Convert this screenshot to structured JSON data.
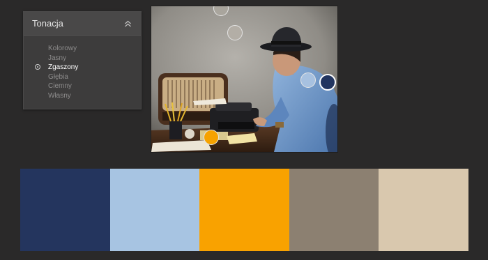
{
  "panel": {
    "title": "Tonacja",
    "collapse_icon": "chevron-double-up-icon",
    "options": [
      {
        "label": "Kolorowy",
        "selected": false
      },
      {
        "label": "Jasny",
        "selected": false
      },
      {
        "label": "Zgaszony",
        "selected": true
      },
      {
        "label": "Głębia",
        "selected": false
      },
      {
        "label": "Ciemny",
        "selected": false
      },
      {
        "label": "Własny",
        "selected": false
      }
    ]
  },
  "photo": {
    "pickers": [
      {
        "name": "picker-wall",
        "color": "#a9a59d"
      },
      {
        "name": "picker-hat",
        "color": "#b3aea6"
      },
      {
        "name": "picker-shirt-light",
        "color": "#a7c1e0"
      },
      {
        "name": "picker-shirt-dark",
        "color": "#223560"
      },
      {
        "name": "picker-pencil",
        "color": "#f6a200"
      }
    ]
  },
  "swatches": [
    {
      "name": "swatch-navy",
      "color": "#24355e"
    },
    {
      "name": "swatch-light-blue",
      "color": "#a7c4e2"
    },
    {
      "name": "swatch-orange",
      "color": "#f9a200"
    },
    {
      "name": "swatch-taupe",
      "color": "#8c8071"
    },
    {
      "name": "swatch-beige",
      "color": "#d9c8ae"
    }
  ]
}
